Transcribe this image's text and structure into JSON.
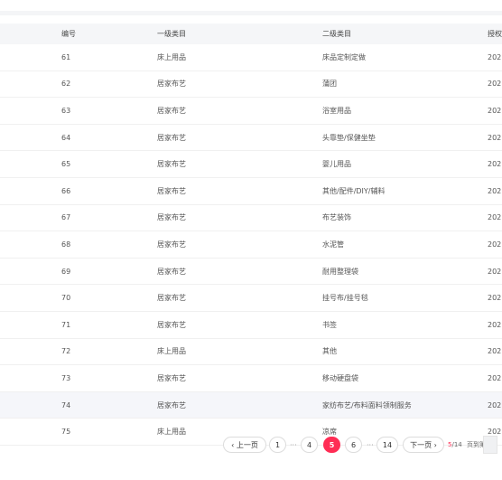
{
  "table": {
    "headers": {
      "no": "编号",
      "level1": "一级类目",
      "level2": "二级类目",
      "auth": "授权"
    },
    "rows": [
      {
        "no": "61",
        "level1": "床上用品",
        "level2": "床品定制定做",
        "auth": "202"
      },
      {
        "no": "62",
        "level1": "居家布艺",
        "level2": "蒲团",
        "auth": "202"
      },
      {
        "no": "63",
        "level1": "居家布艺",
        "level2": "浴室用品",
        "auth": "202"
      },
      {
        "no": "64",
        "level1": "居家布艺",
        "level2": "头靠垫/保健坐垫",
        "auth": "202"
      },
      {
        "no": "65",
        "level1": "居家布艺",
        "level2": "婴儿用品",
        "auth": "202"
      },
      {
        "no": "66",
        "level1": "居家布艺",
        "level2": "其他/配件/DIY/辅料",
        "auth": "202"
      },
      {
        "no": "67",
        "level1": "居家布艺",
        "level2": "布艺装饰",
        "auth": "202"
      },
      {
        "no": "68",
        "level1": "居家布艺",
        "level2": "水泥管",
        "auth": "202"
      },
      {
        "no": "69",
        "level1": "居家布艺",
        "level2": "耐用整理袋",
        "auth": "202"
      },
      {
        "no": "70",
        "level1": "居家布艺",
        "level2": "挂号布/挂号毯",
        "auth": "202"
      },
      {
        "no": "71",
        "level1": "居家布艺",
        "level2": "书签",
        "auth": "202"
      },
      {
        "no": "72",
        "level1": "床上用品",
        "level2": "其他",
        "auth": "202"
      },
      {
        "no": "73",
        "level1": "居家布艺",
        "level2": "移动硬盘袋",
        "auth": "202"
      },
      {
        "no": "74",
        "level1": "居家布艺",
        "level2": "家纺布艺/布料面料领制服务",
        "auth": "202"
      },
      {
        "no": "75",
        "level1": "床上用品",
        "level2": "凉席",
        "auth": "202"
      }
    ]
  },
  "pagination": {
    "prev_label": "‹ 上一页",
    "next_label": "下一页 ›",
    "pages": [
      "1",
      "4",
      "5",
      "6",
      "14"
    ],
    "ellipsis": "···",
    "current": "5",
    "total": "/14",
    "total_suffix": "页到第",
    "accent": "#ff2d55"
  }
}
